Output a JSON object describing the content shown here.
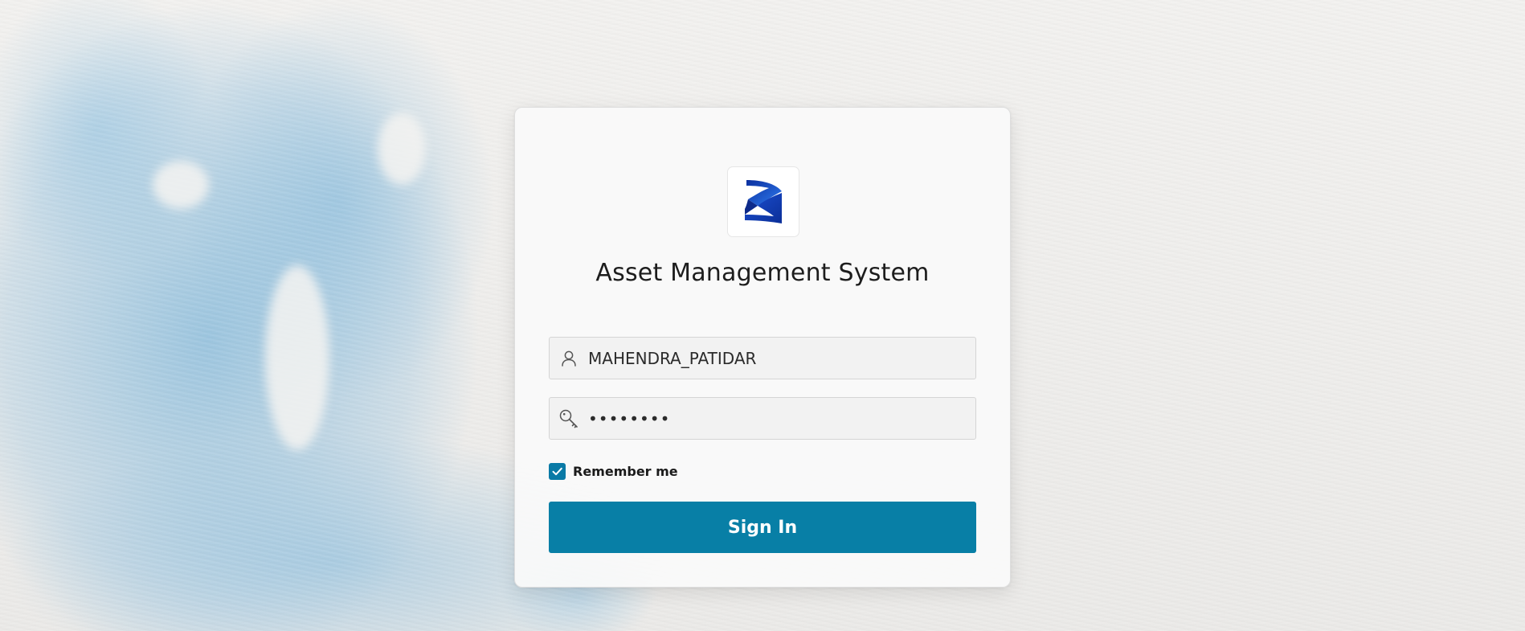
{
  "app": {
    "title": "Asset Management System"
  },
  "form": {
    "username_value": "MAHENDRA_PATIDAR",
    "password_value": "••••••••",
    "remember_label": "Remember me",
    "remember_checked": true,
    "submit_label": "Sign In"
  },
  "icons": {
    "logo": "brand-logo",
    "username": "user-icon",
    "password": "key-icon",
    "checkbox": "checkmark-icon"
  },
  "colors": {
    "primary": "#087fa6",
    "logo_blue": "#1e56d6",
    "title_text": "#1d1d1d"
  }
}
